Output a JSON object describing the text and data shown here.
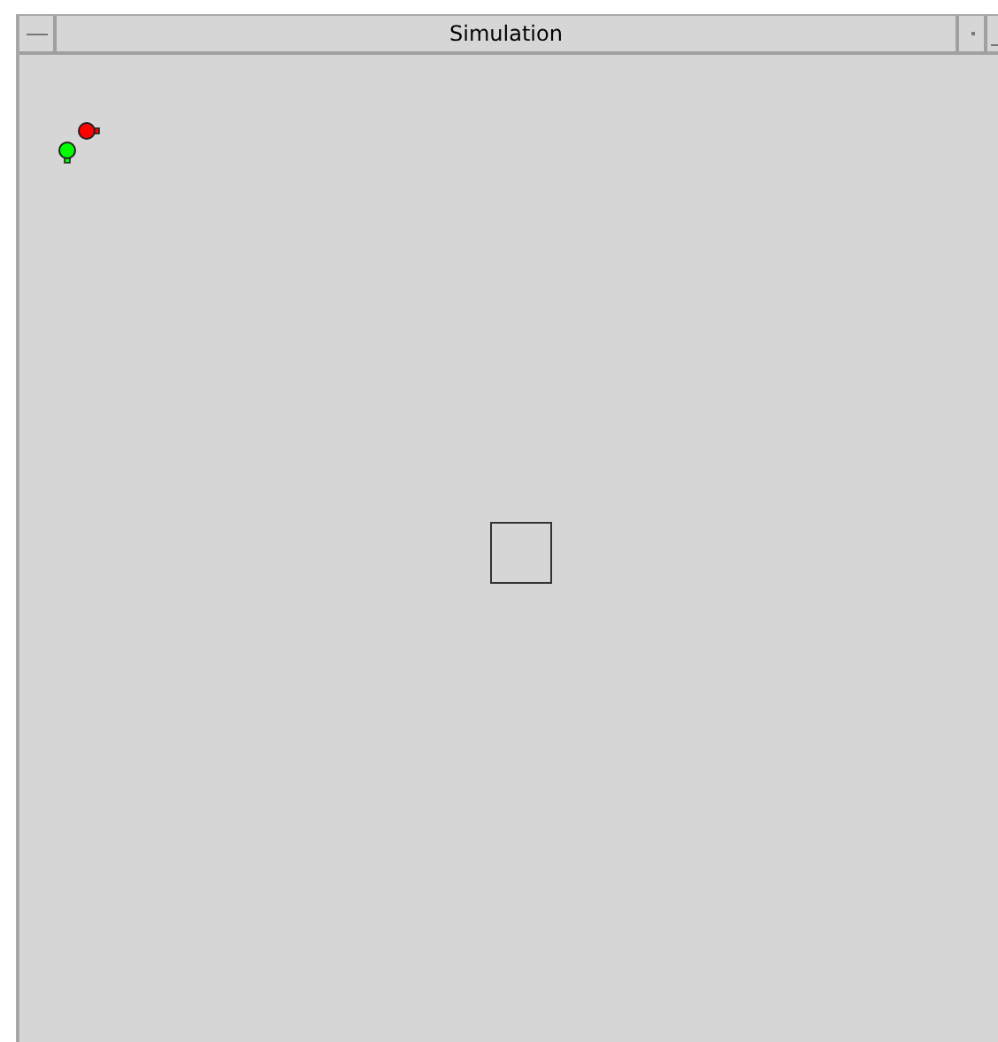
{
  "window": {
    "title": "Simulation"
  },
  "robots": [
    {
      "color": "#ff0000"
    },
    {
      "color": "#00ff00"
    }
  ]
}
